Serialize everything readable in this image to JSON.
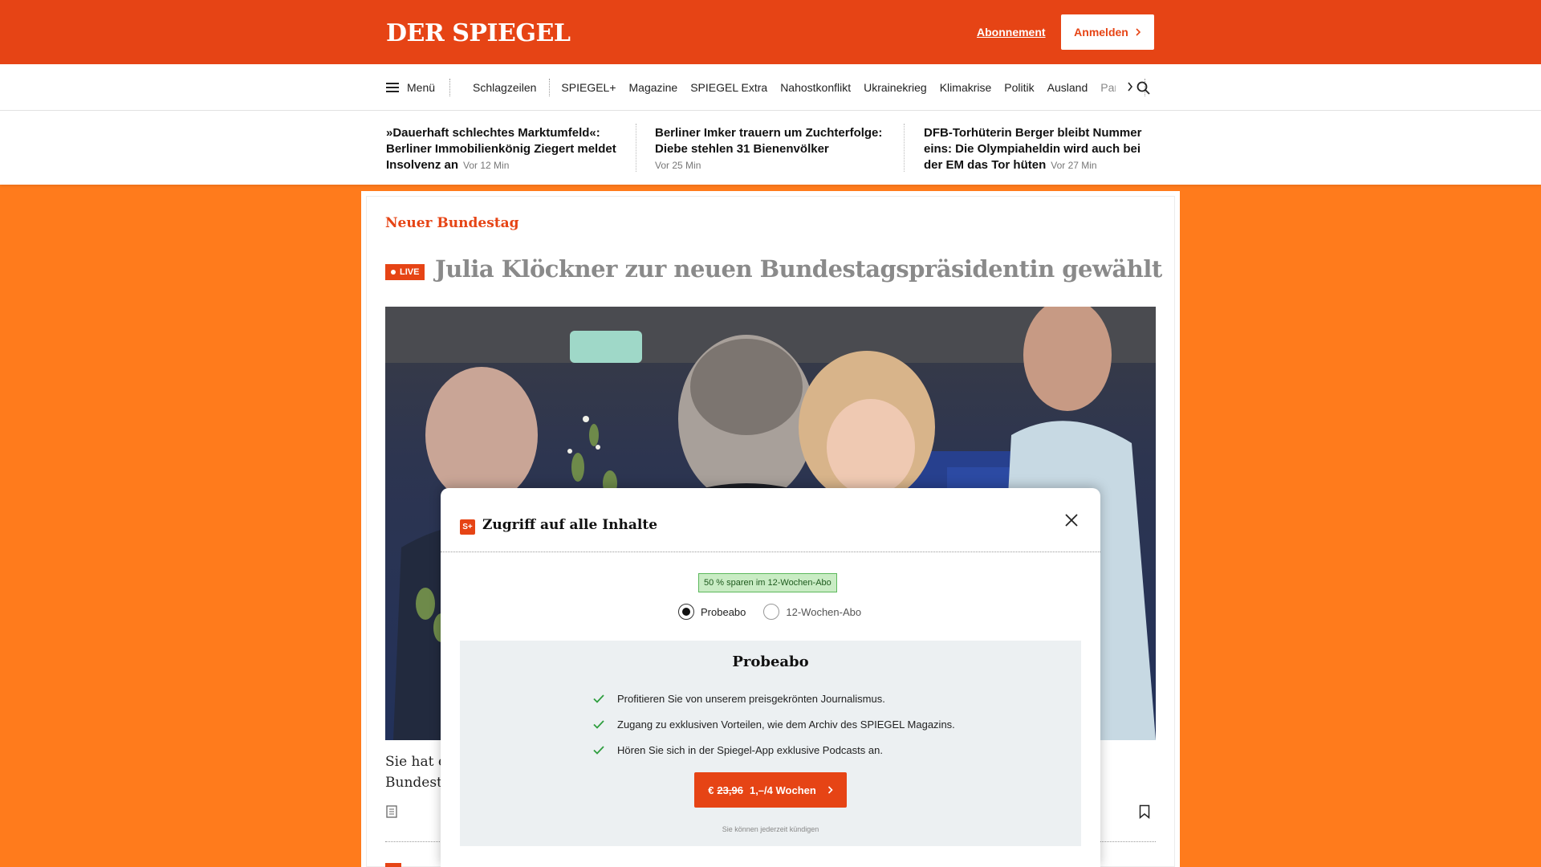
{
  "header": {
    "logo": "DER SPIEGEL",
    "abo_label": "Abonnement",
    "login_label": "Anmelden"
  },
  "nav": {
    "menu_label": "Menü",
    "items": [
      "Schlagzeilen",
      "SPIEGEL+",
      "Magazine",
      "SPIEGEL Extra",
      "Nahostkonflikt",
      "Ukrainekrieg",
      "Klimakrise",
      "Politik",
      "Ausland"
    ],
    "truncated_item": "Panorama"
  },
  "teasers": [
    {
      "title": "»Dauerhaft schlechtes Marktumfeld«: Berliner Immobilienkönig Ziegert meldet Insolvenz an",
      "time": "Vor 12 Min"
    },
    {
      "title": "Berliner Imker trauern um Zuchterfolge: Diebe stehlen 31 Bienenvölker",
      "time": "Vor 25 Min"
    },
    {
      "title": "DFB-Torhüterin Berger bleibt Nummer eins: Die Olympiaheldin wird auch bei der EM das Tor hüten",
      "time": "Vor 27 Min"
    }
  ],
  "article": {
    "kicker": "Neuer Bundestag",
    "live_label": "LIVE",
    "headline": "Julia Klöckner zur neuen Bundestagspräsidentin gewählt",
    "lead_line1": "Sie hat e",
    "lead_line2": "Bundesta"
  },
  "modal": {
    "title": "Zugriff auf alle Inhalte",
    "badge": "50 % sparen im 12-Wochen-Abo",
    "options": [
      "Probeabo",
      "12-Wochen-Abo"
    ],
    "selected_option": "Probeabo",
    "offer_title": "Probeabo",
    "benefits": [
      "Profitieren Sie von unserem preisgekrönten Journalismus.",
      "Zugang zu exklusiven Vorteilen, wie dem Archiv des SPIEGEL Magazins.",
      "Hören Sie sich in der Spiegel-App exklusive Podcasts an."
    ],
    "cta_currency": "€",
    "cta_old_price": "23,96",
    "cta_price": "1,–/4 Wochen",
    "cancel_note": "Sie können jederzeit kündigen"
  },
  "colors": {
    "brand": "#e64415",
    "page_bg": "#ff7b1c",
    "badge_green": "#c9ecc4"
  },
  "icons": [
    "menu-icon",
    "chevron-right-icon",
    "search-icon",
    "document-icon",
    "bookmark-icon",
    "close-icon",
    "check-icon",
    "spiegel-plus-icon"
  ]
}
